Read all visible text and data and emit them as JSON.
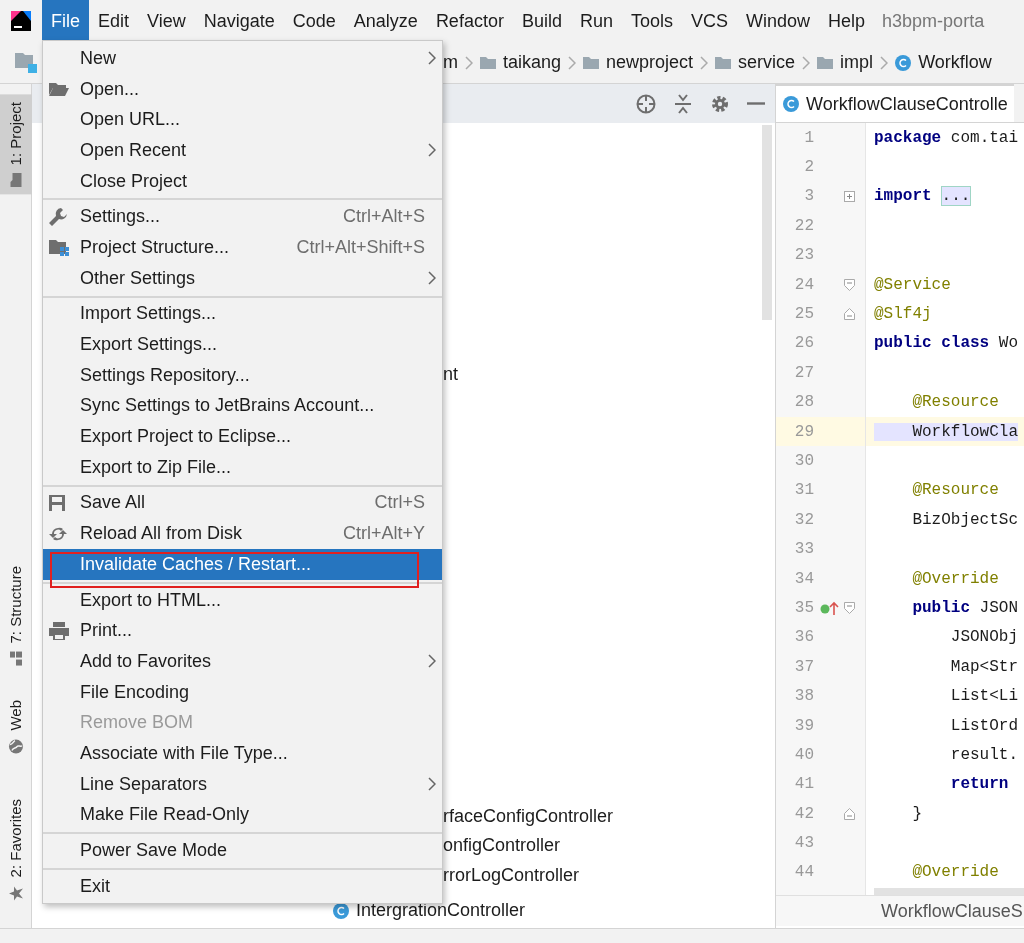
{
  "menu_bar": {
    "items": [
      {
        "label": "File",
        "selected": true
      },
      {
        "label": "Edit",
        "selected": false
      },
      {
        "label": "View",
        "selected": false
      },
      {
        "label": "Navigate",
        "selected": false
      },
      {
        "label": "Code",
        "selected": false
      },
      {
        "label": "Analyze",
        "selected": false
      },
      {
        "label": "Refactor",
        "selected": false
      },
      {
        "label": "Build",
        "selected": false
      },
      {
        "label": "Run",
        "selected": false
      },
      {
        "label": "Tools",
        "selected": false
      },
      {
        "label": "VCS",
        "selected": false
      },
      {
        "label": "Window",
        "selected": false
      },
      {
        "label": "Help",
        "selected": false
      }
    ],
    "title": "h3bpm-porta"
  },
  "breadcrumb": [
    {
      "label": "m",
      "kind": "folder"
    },
    {
      "label": "taikang",
      "kind": "folder"
    },
    {
      "label": "newproject",
      "kind": "folder"
    },
    {
      "label": "service",
      "kind": "folder"
    },
    {
      "label": "impl",
      "kind": "folder"
    },
    {
      "label": "Workflow",
      "kind": "class"
    }
  ],
  "side_tabs": [
    {
      "label": "1: Project",
      "selected": true
    },
    {
      "label": "7: Structure",
      "selected": false
    },
    {
      "label": "Web",
      "selected": false
    },
    {
      "label": "2: Favorites",
      "selected": false
    }
  ],
  "project_tree": [
    {
      "label": "nt",
      "class_icon": false
    },
    {
      "label": "rfaceConfigController",
      "class_icon": false
    },
    {
      "label": "onfigController",
      "class_icon": false
    },
    {
      "label": "rrorLogController",
      "class_icon": false
    },
    {
      "label": "IntergrationController",
      "class_icon": true
    }
  ],
  "file_menu": [
    {
      "kind": "item",
      "label": "New",
      "submenu": true,
      "selected": false,
      "disabled": false
    },
    {
      "kind": "item",
      "label": "Open...",
      "selected": false,
      "disabled": false
    },
    {
      "kind": "item",
      "label": "Open URL...",
      "selected": false,
      "disabled": false
    },
    {
      "kind": "item",
      "label": "Open Recent",
      "submenu": true,
      "selected": false,
      "disabled": false
    },
    {
      "kind": "item",
      "label": "Close Project",
      "selected": false,
      "disabled": false
    },
    {
      "kind": "separator"
    },
    {
      "kind": "item",
      "label": "Settings...",
      "shortcut": "Ctrl+Alt+S",
      "selected": false,
      "disabled": false
    },
    {
      "kind": "item",
      "label": "Project Structure...",
      "shortcut": "Ctrl+Alt+Shift+S",
      "selected": false,
      "disabled": false
    },
    {
      "kind": "item",
      "label": "Other Settings",
      "submenu": true,
      "selected": false,
      "disabled": false
    },
    {
      "kind": "separator"
    },
    {
      "kind": "item",
      "label": "Import Settings...",
      "selected": false,
      "disabled": false
    },
    {
      "kind": "item",
      "label": "Export Settings...",
      "selected": false,
      "disabled": false
    },
    {
      "kind": "item",
      "label": "Settings Repository...",
      "selected": false,
      "disabled": false
    },
    {
      "kind": "item",
      "label": "Sync Settings to JetBrains Account...",
      "selected": false,
      "disabled": false
    },
    {
      "kind": "item",
      "label": "Export Project to Eclipse...",
      "selected": false,
      "disabled": false
    },
    {
      "kind": "item",
      "label": "Export to Zip File...",
      "selected": false,
      "disabled": false
    },
    {
      "kind": "separator"
    },
    {
      "kind": "item",
      "label": "Save All",
      "shortcut": "Ctrl+S",
      "selected": false,
      "disabled": false
    },
    {
      "kind": "item",
      "label": "Reload All from Disk",
      "shortcut": "Ctrl+Alt+Y",
      "selected": false,
      "disabled": false
    },
    {
      "kind": "item",
      "label": "Invalidate Caches / Restart...",
      "selected": true,
      "disabled": false,
      "annotated": true
    },
    {
      "kind": "separator"
    },
    {
      "kind": "item",
      "label": "Export to HTML...",
      "selected": false,
      "disabled": false
    },
    {
      "kind": "item",
      "label": "Print...",
      "selected": false,
      "disabled": false
    },
    {
      "kind": "item",
      "label": "Add to Favorites",
      "submenu": true,
      "selected": false,
      "disabled": false
    },
    {
      "kind": "item",
      "label": "File Encoding",
      "selected": false,
      "disabled": false
    },
    {
      "kind": "item",
      "label": "Remove BOM",
      "selected": false,
      "disabled": true
    },
    {
      "kind": "item",
      "label": "Associate with File Type...",
      "selected": false,
      "disabled": false
    },
    {
      "kind": "item",
      "label": "Line Separators",
      "submenu": true,
      "selected": false,
      "disabled": false
    },
    {
      "kind": "item",
      "label": "Make File Read-Only",
      "selected": false,
      "disabled": false
    },
    {
      "kind": "separator"
    },
    {
      "kind": "item",
      "label": "Power Save Mode",
      "selected": false,
      "disabled": false
    },
    {
      "kind": "separator"
    },
    {
      "kind": "item",
      "label": "Exit",
      "selected": false,
      "disabled": false
    }
  ],
  "editor": {
    "tab": "WorkflowClauseControlle",
    "breadcrumb": "WorkflowClauseS",
    "lines": [
      {
        "number": "1",
        "current": false,
        "kind": "plain",
        "segments": [
          {
            "text": "package",
            "kind": "keyword"
          },
          {
            "text": " com.tai",
            "kind": "plain"
          }
        ]
      },
      {
        "number": "2",
        "current": false,
        "kind": "plain"
      },
      {
        "number": "3",
        "current": false,
        "kind": "fold-expand",
        "segments": [
          {
            "text": "import",
            "kind": "keyword"
          },
          {
            "text": "...",
            "kind": "folded"
          }
        ]
      },
      {
        "number": "22",
        "current": false,
        "kind": "plain"
      },
      {
        "number": "23",
        "current": false,
        "kind": "plain"
      },
      {
        "number": "24",
        "current": false,
        "kind": "fold-start",
        "segments": [
          {
            "text": "@Service",
            "kind": "annotation"
          }
        ]
      },
      {
        "number": "25",
        "current": false,
        "kind": "fold-end",
        "segments": [
          {
            "text": "@Slf4j",
            "kind": "annotation"
          }
        ]
      },
      {
        "number": "26",
        "current": false,
        "kind": "plain",
        "segments": [
          {
            "text": "public class",
            "kind": "keyword"
          },
          {
            "text": " Wo",
            "kind": "plain"
          }
        ]
      },
      {
        "number": "27",
        "current": false,
        "kind": "plain"
      },
      {
        "number": "28",
        "current": false,
        "kind": "plain",
        "segments": [
          {
            "text": "    @Resource",
            "kind": "annotation"
          }
        ]
      },
      {
        "number": "29",
        "current": true,
        "kind": "plain",
        "segments": [
          {
            "text": "    WorkflowCla",
            "kind": "highlighted"
          }
        ]
      },
      {
        "number": "30",
        "current": false,
        "kind": "plain"
      },
      {
        "number": "31",
        "current": false,
        "kind": "plain",
        "segments": [
          {
            "text": "    @Resource",
            "kind": "annotation"
          }
        ]
      },
      {
        "number": "32",
        "current": false,
        "kind": "plain",
        "segments": [
          {
            "text": "    BizObjectSc",
            "kind": "plain"
          }
        ]
      },
      {
        "number": "33",
        "current": false,
        "kind": "plain"
      },
      {
        "number": "34",
        "current": false,
        "kind": "plain",
        "segments": [
          {
            "text": "    @Override",
            "kind": "annotation"
          }
        ]
      },
      {
        "number": "35",
        "current": false,
        "kind": "fold-start",
        "marker": true,
        "segments": [
          {
            "text": "    public",
            "kind": "keyword"
          },
          {
            "text": " JSON",
            "kind": "plain"
          }
        ]
      },
      {
        "number": "36",
        "current": false,
        "kind": "plain",
        "segments": [
          {
            "text": "        JSONObj",
            "kind": "plain"
          }
        ]
      },
      {
        "number": "37",
        "current": false,
        "kind": "plain",
        "segments": [
          {
            "text": "        Map<Str",
            "kind": "plain"
          }
        ]
      },
      {
        "number": "38",
        "current": false,
        "kind": "plain",
        "segments": [
          {
            "text": "        List<Li",
            "kind": "plain"
          }
        ]
      },
      {
        "number": "39",
        "current": false,
        "kind": "plain",
        "segments": [
          {
            "text": "        ListOrd",
            "kind": "plain"
          }
        ]
      },
      {
        "number": "40",
        "current": false,
        "kind": "plain",
        "segments": [
          {
            "text": "        result.",
            "kind": "plain"
          }
        ]
      },
      {
        "number": "41",
        "current": false,
        "kind": "plain",
        "segments": [
          {
            "text": "        return",
            "kind": "keyword"
          }
        ]
      },
      {
        "number": "42",
        "current": false,
        "kind": "fold-end",
        "segments": [
          {
            "text": "    }",
            "kind": "plain"
          }
        ]
      },
      {
        "number": "43",
        "current": false,
        "kind": "plain"
      },
      {
        "number": "44",
        "current": false,
        "kind": "plain",
        "segments": [
          {
            "text": "    @Override",
            "kind": "annotation"
          }
        ]
      }
    ]
  }
}
